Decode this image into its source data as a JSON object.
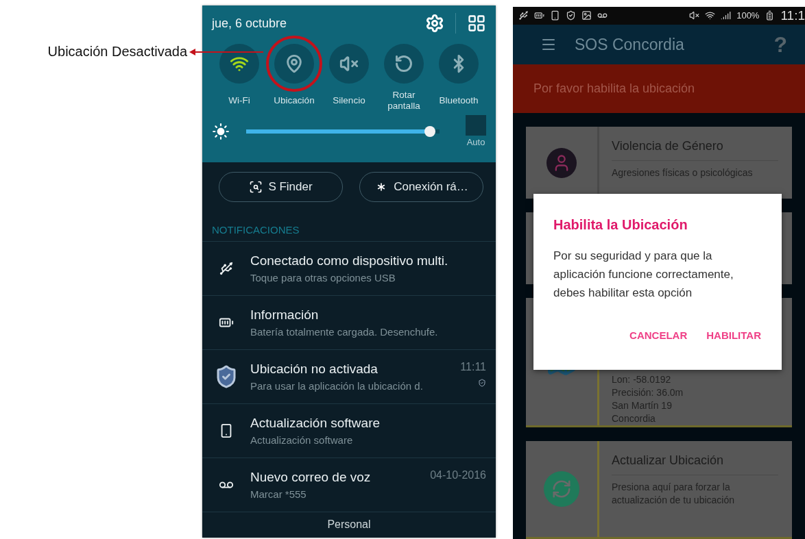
{
  "annotation": {
    "label": "Ubicación Desactivada"
  },
  "panel": {
    "date": "jue, 6 octubre",
    "toggles": [
      {
        "kind": "wifi",
        "label": "Wi-Fi",
        "on": true,
        "highlighted": false
      },
      {
        "kind": "location",
        "label": "Ubicación",
        "on": false,
        "highlighted": true
      },
      {
        "kind": "mute",
        "label": "Silencio",
        "on": false,
        "highlighted": false
      },
      {
        "kind": "rotate",
        "label": "Rotar pantalla",
        "on": false,
        "highlighted": false
      },
      {
        "kind": "bluetooth",
        "label": "Bluetooth",
        "on": false,
        "highlighted": false
      }
    ],
    "brightness": {
      "level": 0.95,
      "auto_label": "Auto",
      "auto_checked": false
    },
    "shortcuts": [
      {
        "kind": "finder",
        "label": "S Finder"
      },
      {
        "kind": "quick-connect",
        "label": "Conexión rá…"
      }
    ],
    "section_title": "NOTIFICACIONES",
    "notifications": [
      {
        "kind": "usb",
        "title": "Conectado como dispositivo multi.",
        "subtitle": "Toque para otras opciones USB"
      },
      {
        "kind": "battery",
        "title": "Información",
        "subtitle": "Batería totalmente cargada. Desenchufe."
      },
      {
        "kind": "shield",
        "title": "Ubicación no activada",
        "subtitle": "Para usar la aplicación la ubicación d.",
        "time": "11:11"
      },
      {
        "kind": "update",
        "title": "Actualización software",
        "subtitle": "Actualización software"
      },
      {
        "kind": "voicemail",
        "title": "Nuevo correo de voz",
        "subtitle": "Marcar *555",
        "time": "04-10-2016"
      }
    ],
    "footer": "Personal"
  },
  "app": {
    "status_bar": {
      "battery": "100%",
      "time": "11:1"
    },
    "title": "SOS Concordia",
    "help": "?",
    "banner": "Por favor habilita la ubicación",
    "cards": [
      {
        "kind": "violence",
        "title": "Violencia de Género",
        "lines": [
          "Agresiones físicas o psicológicas"
        ]
      },
      {
        "kind": "covered"
      },
      {
        "kind": "location",
        "lines": [
          "Lon: -58.0192",
          "Precisión: 36.0m",
          "San Martín 19",
          "Concordia"
        ]
      },
      {
        "kind": "refresh",
        "title": "Actualizar Ubicación",
        "lines": [
          "Presiona aquí para forzar la",
          "actualización de tu ubicación"
        ]
      }
    ],
    "dialog": {
      "title": "Habilita la Ubicación",
      "message": "Por su seguridad y para que la aplicación funcione correctamente, debes habilitar esta opción",
      "buttons": [
        "CANCELAR",
        "HABILITAR"
      ]
    }
  }
}
